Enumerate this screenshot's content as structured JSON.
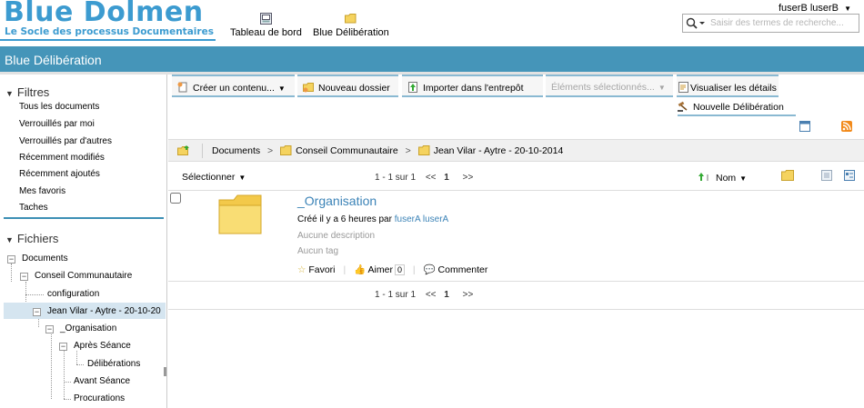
{
  "header": {
    "logo_title": "Blue Dolmen",
    "logo_subtitle": "Le Socle des processus Documentaires",
    "apps": [
      {
        "label": "Tableau de bord",
        "icon": "dashboard-icon"
      },
      {
        "label": "Blue Délibération",
        "icon": "folder-icon"
      }
    ],
    "user_name": "fuserB luserB",
    "search_placeholder": "Saisir des termes de recherche..."
  },
  "site_bar": {
    "title": "Blue Délibération"
  },
  "filters": {
    "title": "Filtres",
    "items": [
      "Tous les documents",
      "Verrouillés par moi",
      "Verrouillés par d'autres",
      "Récemment modifiés",
      "Récemment ajoutés",
      "Mes favoris",
      "Taches"
    ]
  },
  "files": {
    "title": "Fichiers",
    "tree": [
      "Documents",
      "Conseil Communautaire",
      "configuration",
      "Jean Vilar - Aytre - 20-10-20",
      "_Organisation",
      "Après Séance",
      "Délibérations",
      "Avant Séance",
      "Procurations"
    ]
  },
  "toolbar": {
    "create": "Créer un contenu...",
    "new_folder": "Nouveau dossier",
    "import": "Importer dans l'entrepôt",
    "selected": "Éléments sélectionnés...",
    "details": "Visualiser les détails",
    "new_deliberation": "Nouvelle Délibération"
  },
  "breadcrumb": [
    "Documents",
    "Conseil Communautaire",
    "Jean Vilar - Aytre - 20-10-2014"
  ],
  "list": {
    "select_label": "Sélectionner",
    "pager_range": "1 - 1 sur 1",
    "pager_prev": "<<",
    "pager_page": "1",
    "pager_next": ">>",
    "sort_label": "Nom"
  },
  "document": {
    "title": "_Organisation",
    "created_prefix": "Créé il y a 6 heures par",
    "created_by": "fuserA luserA",
    "description": "Aucune description",
    "tags": "Aucun tag",
    "favorite": "Favori",
    "like": "Aimer",
    "like_count": "0",
    "comment": "Commenter"
  },
  "colors": {
    "brand": "#3c9bd0",
    "site_bar": "#4595b9",
    "link": "#3b83b7"
  }
}
